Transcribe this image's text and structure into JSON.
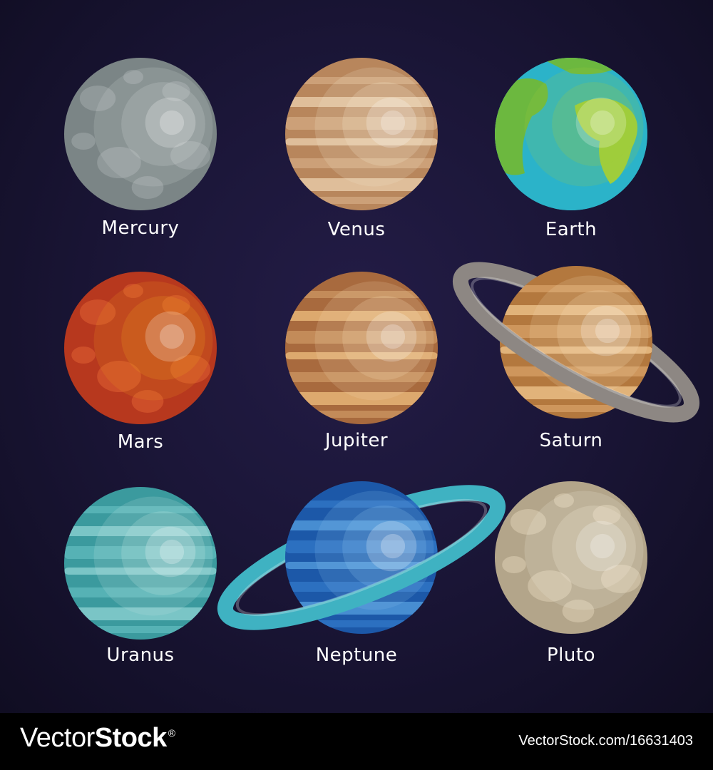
{
  "planets": {
    "mercury": {
      "label": "Mercury",
      "colors": [
        "#7b8586",
        "#969e9f",
        "#b4bbbb",
        "#d3d8d8"
      ]
    },
    "venus": {
      "label": "Venus",
      "colors": [
        "#b8865c",
        "#cfa47c",
        "#e5c8a4",
        "#f6e7cf"
      ]
    },
    "earth": {
      "label": "Earth",
      "colors": [
        "#2bb3c9",
        "#48c7d6",
        "#6cb83f",
        "#9fce3c"
      ]
    },
    "mars": {
      "label": "Mars",
      "colors": [
        "#b7381e",
        "#d2542c",
        "#e67640",
        "#ee9a22"
      ]
    },
    "jupiter": {
      "label": "Jupiter",
      "colors": [
        "#a86a3e",
        "#c8915e",
        "#e6b477",
        "#f4d9b2"
      ]
    },
    "saturn": {
      "label": "Saturn",
      "colors": [
        "#b3783e",
        "#d29b62",
        "#e9bd85",
        "#f4d9b2"
      ],
      "ring": "#8d8783"
    },
    "uranus": {
      "label": "Uranus",
      "colors": [
        "#3b9a9e",
        "#5cb6b8",
        "#86cdcd",
        "#c3e6e4"
      ]
    },
    "neptune": {
      "label": "Neptune",
      "colors": [
        "#1c58a8",
        "#2f74c4",
        "#4f96d8",
        "#8cc2ec"
      ],
      "ring": "#3fb2c2"
    },
    "pluto": {
      "label": "Pluto",
      "colors": [
        "#b3a58a",
        "#cfc2a6",
        "#e6dcc2",
        "#f6eedb"
      ]
    }
  },
  "footer": {
    "brand_light": "Vector",
    "brand_bold": "Stock",
    "registered": "®",
    "image_url": "VectorStock.com/16631403"
  }
}
